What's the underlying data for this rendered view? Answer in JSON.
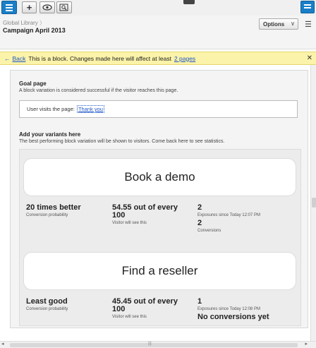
{
  "toolbar": {
    "add_label": "+"
  },
  "header": {
    "breadcrumb": "Global Library",
    "campaign": "Campaign April 2013",
    "options_label": "Options"
  },
  "banner": {
    "back_label": "Back",
    "text": "This is a block. Changes made here will affect at least",
    "pages_link": "2 pages"
  },
  "goal": {
    "title": "Goal page",
    "subtitle": "A block variation is considered successful if the visitor reaches this page.",
    "rule_text": "User visits the page:",
    "rule_link": "Thank you"
  },
  "variants": {
    "title": "Add your variants here",
    "subtitle": "The best performing block variation will be shown to visitors. Come back here to see statistics.",
    "items": [
      {
        "name": "Book a demo",
        "rank": "20 times better",
        "rank_label": "Conversion probability",
        "visitors": "54.55 out of every 100",
        "visitors_label": "Visitor will see this",
        "exposures": "2",
        "exposures_label": "Exposures since Today 12:07 PM",
        "conversions": "2",
        "conversions_label": "Conversions"
      },
      {
        "name": "Find a reseller",
        "rank": "Least good",
        "rank_label": "Conversion probability",
        "visitors": "45.45 out of every 100",
        "visitors_label": "Visitor will see this",
        "exposures": "1",
        "exposures_label": "Exposures since Today 12:08 PM",
        "conversions": "No conversions yet"
      }
    ]
  },
  "colors": {
    "accent_blue": "#1a7fc8",
    "banner_yellow": "#fbf3a9",
    "link_blue": "#1f56c8"
  },
  "icons": [
    "menu-icon",
    "plus-icon",
    "eye-icon",
    "zoom-icon",
    "chevron-down-icon",
    "list-icon",
    "close-icon",
    "back-arrow-icon"
  ]
}
